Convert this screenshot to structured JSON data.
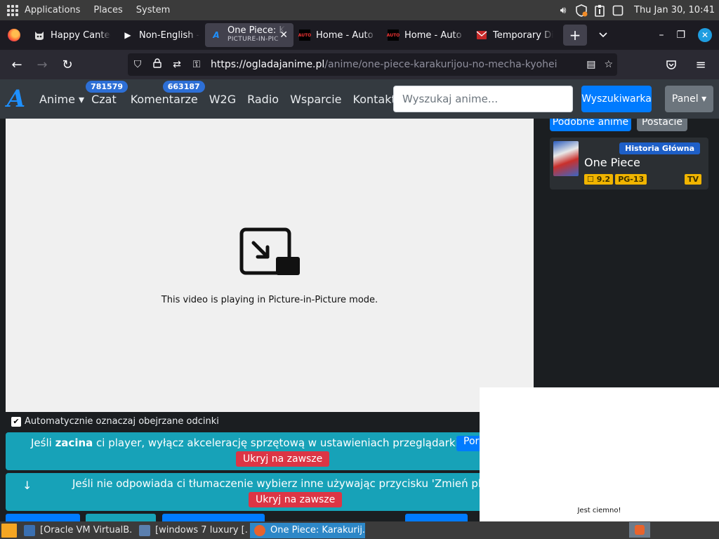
{
  "system_panel": {
    "menus": [
      "Applications",
      "Places",
      "System"
    ],
    "clock": "Thu Jan 30, 10:41"
  },
  "browser": {
    "tabs": [
      {
        "title": "Happy Cantee",
        "favicon": "cat-icon",
        "active": false
      },
      {
        "title": "Non-English -",
        "favicon": "play-icon",
        "active": false
      },
      {
        "title": "One Piece: K",
        "subtitle": "PICTURE-IN-PIC",
        "favicon": "a-logo-icon",
        "active": true
      },
      {
        "title": "Home - Auto D",
        "favicon": "auto-icon",
        "active": false
      },
      {
        "title": "Home - Auto D",
        "favicon": "auto-icon",
        "active": false
      },
      {
        "title": "Temporary Dis",
        "favicon": "mail-icon",
        "active": false
      }
    ],
    "new_tab": "+",
    "url_domain": "https://ogladajanime.pl",
    "url_path": "/anime/one-piece-karakurijou-no-mecha-kyohei"
  },
  "site": {
    "logo": "A",
    "nav": [
      {
        "label": "Anime ▾",
        "badge": ""
      },
      {
        "label": "Czat",
        "badge": "781579"
      },
      {
        "label": "Komentarze",
        "badge": "663187"
      },
      {
        "label": "W2G",
        "badge": ""
      },
      {
        "label": "Radio",
        "badge": ""
      },
      {
        "label": "Wsparcie",
        "badge": ""
      },
      {
        "label": "Kontakt",
        "badge": ""
      }
    ],
    "search_placeholder": "Wyszukaj anime...",
    "search_button": "Wyszukiwarka",
    "panel_button": "Panel ▾"
  },
  "player": {
    "pip_message": "This video is playing in Picture-in-Picture mode."
  },
  "options": {
    "auto_mark_label": "Automatycznie oznaczaj obejrzane odcinki",
    "auto_mark_checked": true
  },
  "alerts": [
    {
      "text_before": "Jeśli ",
      "text_bold": "zacina",
      "text_after": " ci player, wyłącz akcelerację sprzętową w ustawieniach przeglądarki.",
      "extra_button": "Pora",
      "hide_label": "Ukryj na zawsze"
    },
    {
      "arrow": "↓",
      "text": "Jeśli nie odpowiada ci tłumaczenie wybierz inne używając przycisku 'Zmień player",
      "hide_label": "Ukryj na zawsze"
    }
  ],
  "sidebar": {
    "buttons": [
      "Podobne anime",
      "Postacie"
    ],
    "card": {
      "tag": "Historia Główna",
      "title": "One Piece",
      "rating": "9.2",
      "age": "PG-13",
      "type": "TV"
    }
  },
  "pip_window": {
    "caption": "Jest ciemno!"
  },
  "taskbar": {
    "items": [
      {
        "label": "[Oracle VM VirtualB...",
        "active": false
      },
      {
        "label": "[windows 7 luxury [...",
        "active": false
      },
      {
        "label": "One Piece: Karakurij...",
        "active": true
      }
    ]
  }
}
